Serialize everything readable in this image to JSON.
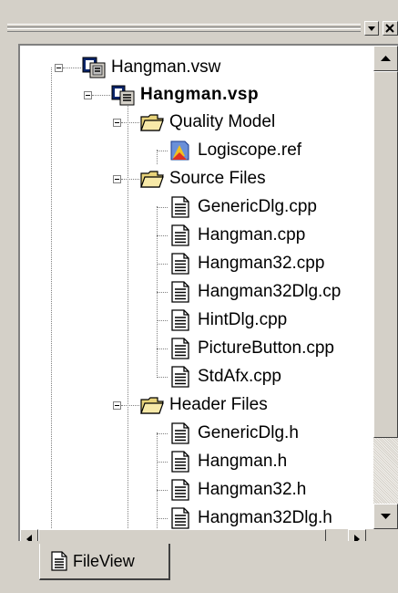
{
  "window": {
    "title_buttons": [
      {
        "name": "dropdown-icon",
        "glyph": "▾"
      },
      {
        "name": "close-icon",
        "glyph": "×"
      }
    ]
  },
  "tree": {
    "nodes": [
      {
        "label": "Hangman.vsw",
        "icon": "workspace-icon",
        "expanded": true,
        "bold": false
      },
      {
        "label": "Hangman.vsp",
        "icon": "project-icon",
        "expanded": true,
        "bold": true
      },
      {
        "label": "Quality Model",
        "icon": "folder-icon",
        "expanded": true,
        "bold": false
      },
      {
        "label": "Logiscope.ref",
        "icon": "logiscope-icon",
        "bold": false
      },
      {
        "label": "Source Files",
        "icon": "folder-icon",
        "expanded": true,
        "bold": false
      },
      {
        "label": "GenericDlg.cpp",
        "icon": "document-icon",
        "bold": false
      },
      {
        "label": "Hangman.cpp",
        "icon": "document-icon",
        "bold": false
      },
      {
        "label": "Hangman32.cpp",
        "icon": "document-icon",
        "bold": false
      },
      {
        "label": "Hangman32Dlg.cp",
        "icon": "document-icon",
        "bold": false
      },
      {
        "label": "HintDlg.cpp",
        "icon": "document-icon",
        "bold": false
      },
      {
        "label": "PictureButton.cpp",
        "icon": "document-icon",
        "bold": false
      },
      {
        "label": "StdAfx.cpp",
        "icon": "document-icon",
        "bold": false
      },
      {
        "label": "Header Files",
        "icon": "folder-icon",
        "expanded": true,
        "bold": false
      },
      {
        "label": "GenericDlg.h",
        "icon": "document-icon",
        "bold": false
      },
      {
        "label": "Hangman.h",
        "icon": "document-icon",
        "bold": false
      },
      {
        "label": "Hangman32.h",
        "icon": "document-icon",
        "bold": false
      },
      {
        "label": "Hangman32Dlg.h",
        "icon": "document-icon",
        "bold": false
      }
    ]
  },
  "tabs": [
    {
      "label": "FileView",
      "icon": "document-icon",
      "active": true
    }
  ],
  "colors": {
    "face": "#d4d0c8",
    "folder": "#e8d37a",
    "project": "#0a246a"
  }
}
